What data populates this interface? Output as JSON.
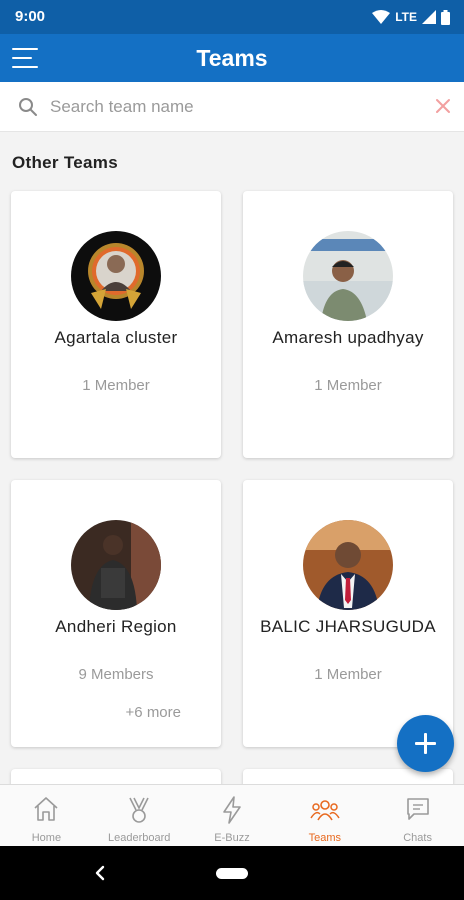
{
  "status": {
    "time": "9:00",
    "network": "LTE"
  },
  "header": {
    "title": "Teams"
  },
  "search": {
    "placeholder": "Search team name",
    "value": ""
  },
  "section_title": "Other Teams",
  "teams": [
    {
      "name": "Agartala cluster",
      "members": "1 Member",
      "more": ""
    },
    {
      "name": "Amaresh upadhyay",
      "members": "1 Member",
      "more": ""
    },
    {
      "name": "Andheri Region",
      "members": "9 Members",
      "more": "+6 more"
    },
    {
      "name": "BALIC JHARSUGUDA",
      "members": "1 Member",
      "more": ""
    }
  ],
  "nav": [
    {
      "label": "Home",
      "icon": "home-icon"
    },
    {
      "label": "Leaderboard",
      "icon": "trophy-icon"
    },
    {
      "label": "E-Buzz",
      "icon": "lightning-icon"
    },
    {
      "label": "Teams",
      "icon": "team-icon",
      "active": true
    },
    {
      "label": "Chats",
      "icon": "chat-icon"
    }
  ],
  "colors": {
    "primary": "#1470c4",
    "status_bar": "#0f5fa7",
    "active": "#e8691f",
    "muted": "#9a9a9a"
  }
}
